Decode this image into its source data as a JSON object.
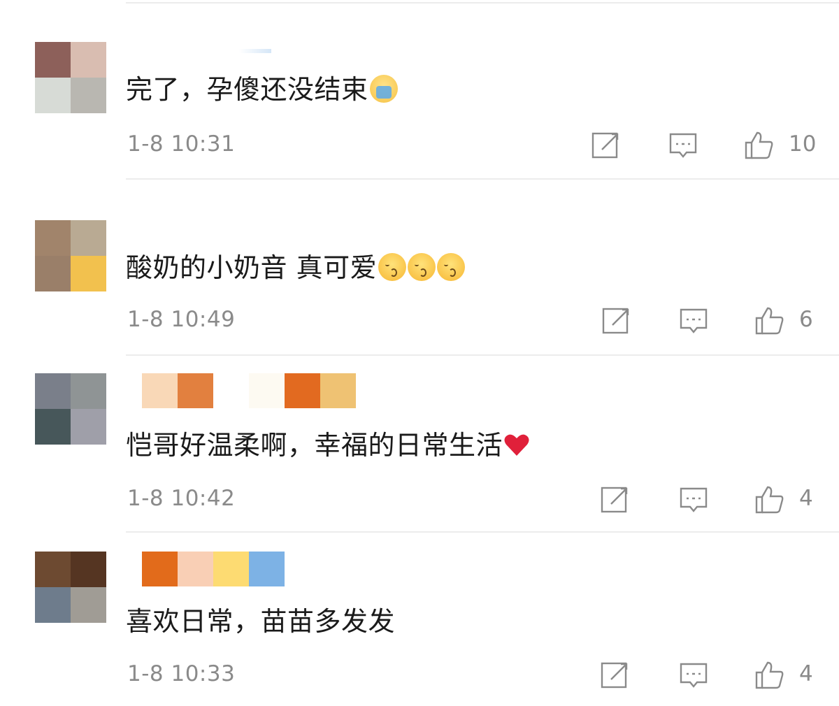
{
  "comments": [
    {
      "avatar_colors": [
        "#8d605a",
        "#d9bdb1",
        "#d7dbd6",
        "#b9b7b1"
      ],
      "name_colors": [],
      "text": "完了，孕傻还没结束",
      "emoji": "loudly-crying-face-icon",
      "time": "1-8 10:31",
      "likes": "10"
    },
    {
      "avatar_colors": [
        "#a1846b",
        "#b9aa93",
        "#9a7f69",
        "#f2c14e"
      ],
      "name_colors": [],
      "text": "酸奶的小奶音 真可爱",
      "emoji": "kissing-face-icon",
      "time": "1-8 10:49",
      "likes": "6"
    },
    {
      "avatar_colors": [
        "#7a7f8a",
        "#8f9495",
        "#47575a",
        "#9f9fa9"
      ],
      "name_colors": [
        "#f9d8b7",
        "#e2803f",
        "#ffffff",
        "#fdfaf2",
        "#e26a20",
        "#efc273"
      ],
      "text": "恺哥好温柔啊，幸福的日常生活",
      "emoji": "red-heart-icon",
      "time": "1-8 10:42",
      "likes": "4"
    },
    {
      "avatar_colors": [
        "#6d4a31",
        "#553522",
        "#6e7c8c",
        "#a09c95"
      ],
      "name_colors": [
        "#e26b1b",
        "#f9cfb5",
        "#fddb72",
        "#7db2e5"
      ],
      "text": "喜欢日常，苗苗多发发",
      "emoji": "",
      "time": "1-8 10:33",
      "likes": "4"
    }
  ],
  "actions": {
    "share_icon": "share-edit-icon",
    "reply_icon": "comment-icon",
    "like_icon": "thumbs-up-icon"
  }
}
